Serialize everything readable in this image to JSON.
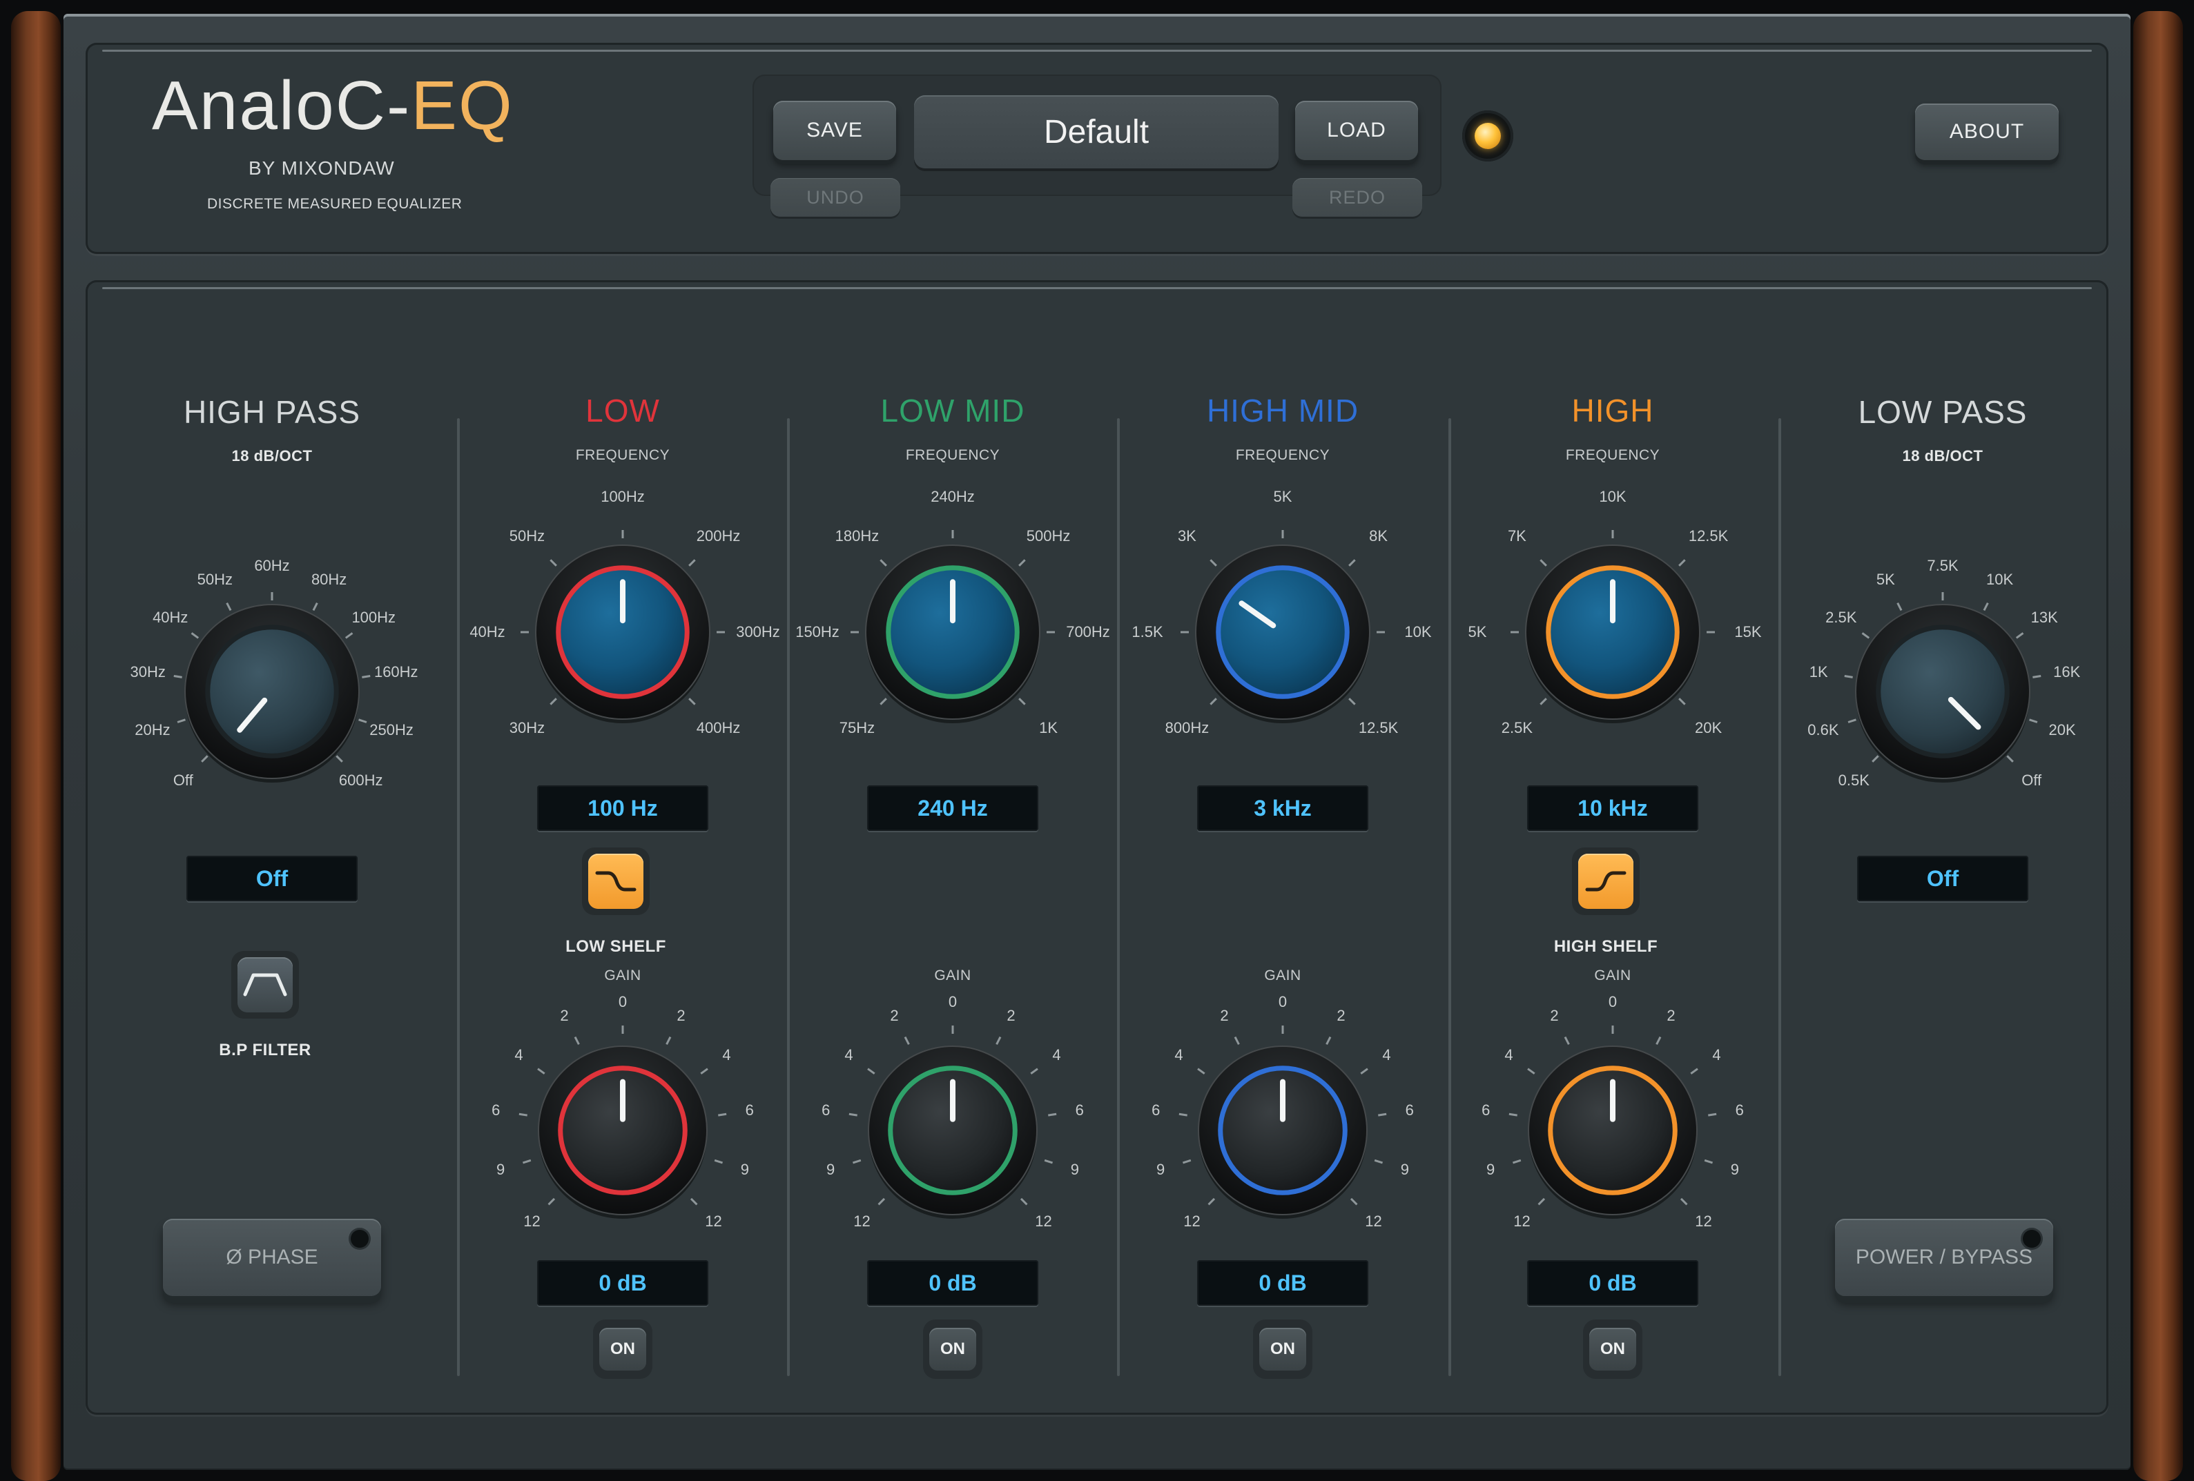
{
  "header": {
    "logo_prefix": "AnaloC-",
    "logo_suffix": "EQ",
    "byline": "BY MIXONDAW",
    "tagline": "DISCRETE MEASURED EQUALIZER",
    "save_label": "SAVE",
    "load_label": "LOAD",
    "undo_label": "UNDO",
    "redo_label": "REDO",
    "preset_name": "Default",
    "about_label": "ABOUT",
    "indicator_color": "#ffc23a"
  },
  "high_pass": {
    "title": "HIGH PASS",
    "slope": "18 dB/OCT",
    "ticks": [
      "Off",
      "20Hz",
      "30Hz",
      "40Hz",
      "50Hz",
      "60Hz",
      "80Hz",
      "100Hz",
      "160Hz",
      "250Hz",
      "600Hz"
    ],
    "value": "Off",
    "bp_filter_label": "B.P FILTER",
    "phase_label": "Ø PHASE"
  },
  "low_pass": {
    "title": "LOW PASS",
    "slope": "18 dB/OCT",
    "ticks": [
      "0.5K",
      "0.6K",
      "1K",
      "2.5K",
      "5K",
      "7.5K",
      "10K",
      "13K",
      "16K",
      "20K",
      "Off"
    ],
    "value": "Off",
    "power_label": "POWER / BYPASS"
  },
  "gain_ticks": [
    "12",
    "9",
    "6",
    "4",
    "2",
    "0",
    "2",
    "4",
    "6",
    "9",
    "12"
  ],
  "bands": [
    {
      "title": "LOW",
      "color": "#e0343b",
      "frequency_label": "FREQUENCY",
      "freq_ticks": [
        "30Hz",
        "40Hz",
        "50Hz",
        "100Hz",
        "200Hz",
        "300Hz",
        "400Hz"
      ],
      "freq_value": "100 Hz",
      "shape_label": "LOW SHELF",
      "gain_label": "GAIN",
      "gain_value": "0 dB",
      "on_label": "ON"
    },
    {
      "title": "LOW MID",
      "color": "#2fa26a",
      "frequency_label": "FREQUENCY",
      "freq_ticks": [
        "75Hz",
        "150Hz",
        "180Hz",
        "240Hz",
        "500Hz",
        "700Hz",
        "1K"
      ],
      "freq_value": "240 Hz",
      "gain_label": "GAIN",
      "gain_value": "0 dB",
      "on_label": "ON"
    },
    {
      "title": "HIGH MID",
      "color": "#2f6fd6",
      "frequency_label": "FREQUENCY",
      "freq_ticks": [
        "800Hz",
        "1.5K",
        "3K",
        "5K",
        "8K",
        "10K",
        "12.5K"
      ],
      "freq_value": "3 kHz",
      "gain_label": "GAIN",
      "gain_value": "0 dB",
      "on_label": "ON"
    },
    {
      "title": "HIGH",
      "color": "#f3922a",
      "frequency_label": "FREQUENCY",
      "freq_ticks": [
        "2.5K",
        "5K",
        "7K",
        "10K",
        "12.5K",
        "15K",
        "20K"
      ],
      "freq_value": "10 kHz",
      "shape_label": "HIGH SHELF",
      "gain_label": "GAIN",
      "gain_value": "0 dB",
      "on_label": "ON"
    }
  ]
}
